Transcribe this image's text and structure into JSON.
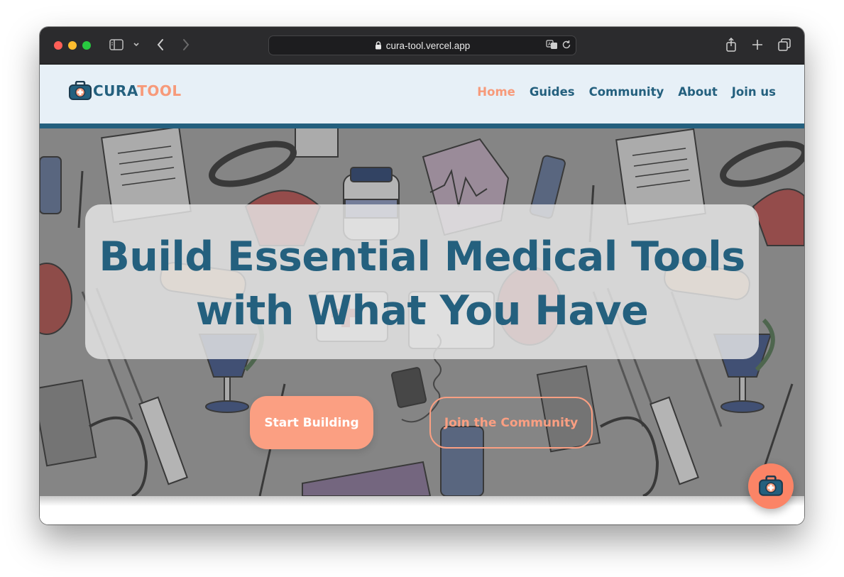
{
  "browser": {
    "url": "cura-tool.vercel.app"
  },
  "site": {
    "logo": {
      "part1": "CURA",
      "part2": "TOOL"
    },
    "nav": [
      {
        "label": "Home",
        "active": true
      },
      {
        "label": "Guides",
        "active": false
      },
      {
        "label": "Community",
        "active": false
      },
      {
        "label": "About",
        "active": false
      },
      {
        "label": "Join us",
        "active": false
      }
    ],
    "hero": {
      "headline_line1": "Build Essential Medical Tools",
      "headline_line2": "with What You Have",
      "primary_button": "Start Building",
      "secondary_button": "Join the Community"
    }
  },
  "colors": {
    "brand_dark": "#24607e",
    "brand_accent": "#f79a7a",
    "button_fill": "#fb9f82",
    "navbar_bg": "#e7f0f7"
  }
}
